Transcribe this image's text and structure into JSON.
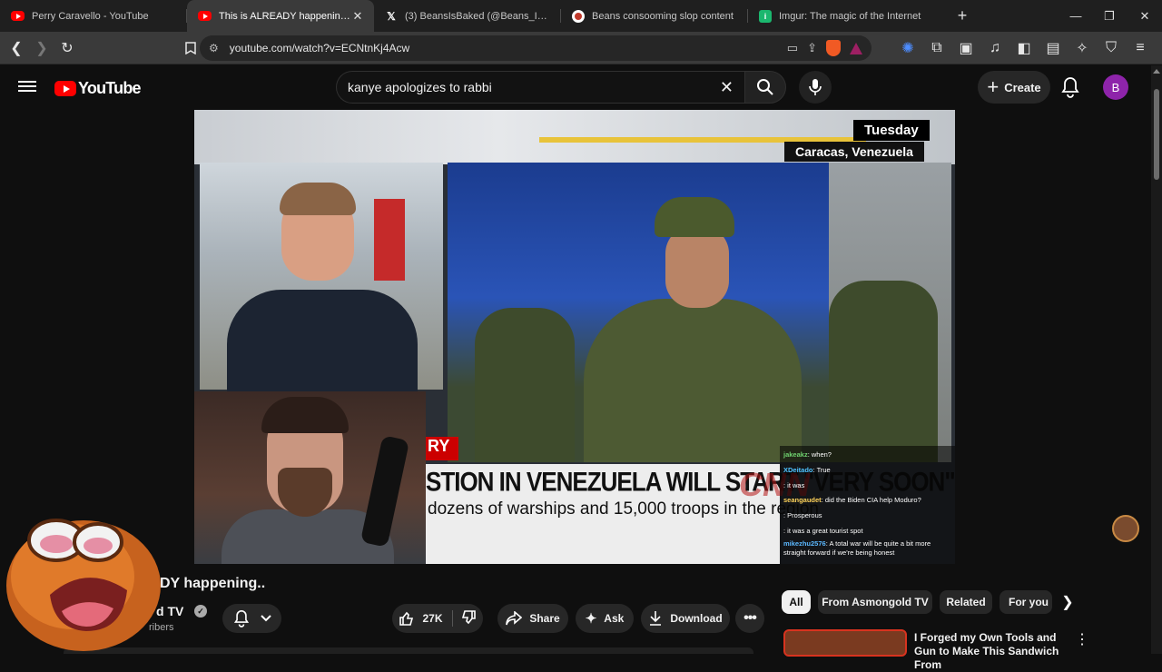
{
  "browser": {
    "tabs": [
      {
        "title": "Perry Caravello - YouTube",
        "icon": "youtube-icon",
        "active": false
      },
      {
        "title": "This is ALREADY happening.. - Yo",
        "icon": "youtube-icon",
        "active": true
      },
      {
        "title": "(3) BeansIsBaked (@Beans_Is_Baked)",
        "icon": "x-icon",
        "active": false
      },
      {
        "title": "Beans consooming slop content",
        "icon": "beans-icon",
        "active": false
      },
      {
        "title": "Imgur: The magic of the Internet",
        "icon": "imgur-icon",
        "active": false
      }
    ],
    "new_tab": "+",
    "url": "youtube.com/watch?v=ECNtnKj4Acw"
  },
  "youtube": {
    "logo_text": "YouTube",
    "search_value": "kanye apologizes to rabbi",
    "create_label": "Create",
    "avatar_letter": "B"
  },
  "video": {
    "overlay_day": "Tuesday",
    "overlay_location": "Caracas, Venezuela",
    "breaking_fragment": "RY",
    "headline": "STION IN VENEZUELA WILL START \"VERY SOON\"",
    "subheadline": "dozens of warships and 15,000 troops in the region",
    "network": "CNN",
    "chat": [
      {
        "user": "jakeakz",
        "color": "#6fd16f",
        "text": "when?"
      },
      {
        "user": "XDeitado",
        "color": "#4ec3ff",
        "text": "True"
      },
      {
        "user": "",
        "color": "#b47cff",
        "text": "it was"
      },
      {
        "user": "seangaudet",
        "color": "#ffd35a",
        "text": "did the Biden CIA help Moduro?"
      },
      {
        "user": "",
        "color": "#5ee0a0",
        "text": "Prosperous"
      },
      {
        "user": "",
        "color": "#ff6b6b",
        "text": "it was a great tourist spot"
      },
      {
        "user": "mikezhu2576",
        "color": "#5bb8ff",
        "text": "A total war will be quite a bit more straight forward if we're being honest"
      }
    ]
  },
  "below_player": {
    "title_fragment": "DY happening..",
    "channel_fragment": "d TV",
    "subs_fragment": "ribers",
    "likes": "27K",
    "share_label": "Share",
    "ask_label": "Ask",
    "download_label": "Download"
  },
  "sidebar": {
    "chips": [
      "All",
      "From Asmongold TV",
      "Related",
      "For you"
    ],
    "rec_title": "I Forged my Own Tools and Gun to Make This Sandwich From"
  },
  "colors": {
    "youtube_red": "#ff0000",
    "avatar_purple": "#8e24aa",
    "page_bg": "#0f0f0f"
  }
}
